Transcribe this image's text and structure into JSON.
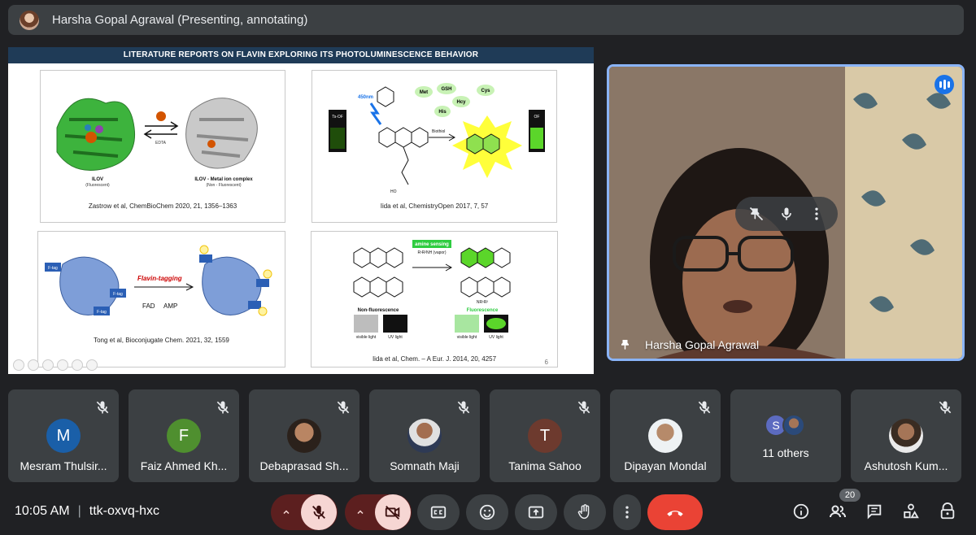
{
  "presenter_banner": {
    "text": "Harsha Gopal Agrawal (Presenting, annotating)"
  },
  "slide": {
    "header": "LITERATURE REPORTS ON FLAVIN EXPLORING ITS PHOTOLUMINESCENCE BEHAVIOR",
    "page_number": "6",
    "panels": [
      {
        "citation": "Zastrow et al, ChemBioChem 2020, 21, 1356–1363",
        "labels": [
          "ILOV",
          "(Fluorescent)",
          "ILOV - Metal ion complex",
          "(Non - Fluorescent)",
          "EDTA"
        ]
      },
      {
        "citation": "Iida et al, ChemistryOpen 2017, 7, 57",
        "labels": [
          "450nm",
          "Ts-OF",
          "OF",
          "Met",
          "GSH",
          "Cys",
          "His",
          "Hcy",
          "Biothiol",
          "HO"
        ]
      },
      {
        "citation": "Tong et al, Bioconjugate Chem. 2021, 32, 1559",
        "labels": [
          "F-tag",
          "F-tag",
          "F-tag",
          "Flavin-tagging",
          "FAD",
          "AMP"
        ]
      },
      {
        "citation": "Iida et al, Chem. – A Eur. J. 2014, 20, 4257",
        "labels": [
          "amine sensing",
          "R¹R²NH (vapor)",
          "Non-fluorescence",
          "Fluorescence",
          "visible light",
          "UV light",
          "visible light",
          "UV light",
          "NR¹R²"
        ]
      }
    ]
  },
  "speaker": {
    "name": "Harsha Gopal Agrawal"
  },
  "participants": [
    {
      "name": "Mesram Thulsir...",
      "initial": "M",
      "color": "#1a5fa8"
    },
    {
      "name": "Faiz Ahmed Kh...",
      "initial": "F",
      "color": "#4f8f2f"
    },
    {
      "name": "Debaprasad Sh...",
      "initial": "",
      "color": "#5a4634"
    },
    {
      "name": "Somnath Maji",
      "initial": "",
      "color": "#d7d7d7"
    },
    {
      "name": "Tanima Sahoo",
      "initial": "T",
      "color": "#6d3a2e"
    },
    {
      "name": "Dipayan Mondal",
      "initial": "",
      "color": "#cfd8dc"
    },
    {
      "name": "Ashutosh Kum...",
      "initial": "",
      "color": "#5c4a3a"
    }
  ],
  "others": {
    "label": "11 others",
    "initial": "S",
    "color": "#5c6bc0"
  },
  "bottom_bar": {
    "time": "10:05 AM",
    "meeting_code": "ttk-oxvq-hxc",
    "people_count": "20"
  }
}
